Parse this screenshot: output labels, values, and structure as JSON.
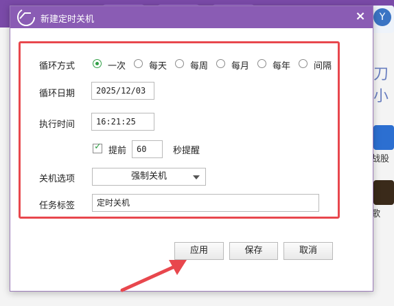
{
  "dialog": {
    "title": "新建定时关机",
    "close_label": "×"
  },
  "form": {
    "loop_mode_label": "循环方式",
    "loop_options": [
      "一次",
      "每天",
      "每周",
      "每月",
      "每年",
      "间隔"
    ],
    "loop_selected": "一次",
    "loop_date_label": "循环日期",
    "loop_date_value": "2025/12/03",
    "exec_time_label": "执行时间",
    "exec_time_value": "16:21:25",
    "remind_checkbox_label": "提前",
    "remind_checked": true,
    "remind_value": "60",
    "remind_suffix": "秒提醒",
    "shutdown_option_label": "关机选项",
    "shutdown_option_value": "强制关机",
    "task_tag_label": "任务标签",
    "task_tag_value": "定时关机"
  },
  "buttons": {
    "apply": "应用",
    "save": "保存",
    "cancel": "取消"
  },
  "background": {
    "right_text_1": "战股",
    "right_text_2": "歌",
    "big_text": "刀小"
  },
  "colors": {
    "titlebar": "#8a5cb4",
    "highlight_border": "#e8474d",
    "radio_selected": "#2f9e45"
  },
  "icons": {
    "app_logo": "app-logo-icon",
    "close": "close-icon",
    "dropdown_caret": "chevron-down-icon",
    "annotation_arrow": "red-arrow-annotation"
  }
}
